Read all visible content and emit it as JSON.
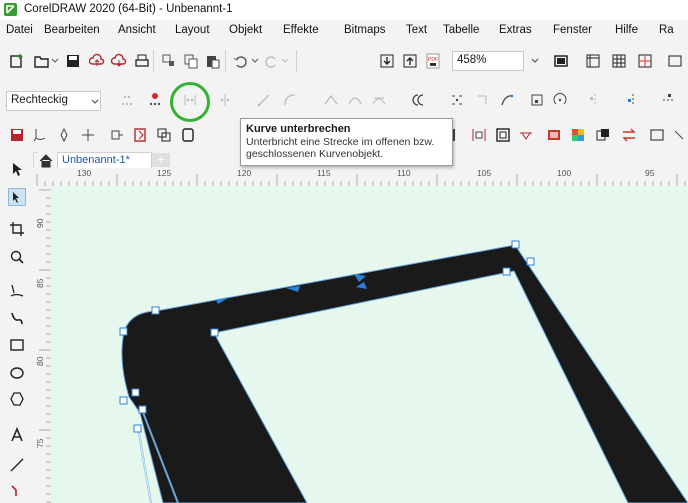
{
  "window": {
    "title": "CorelDRAW 2020 (64-Bit) - Unbenannt-1"
  },
  "menu": {
    "items": [
      "Datei",
      "Bearbeiten",
      "Ansicht",
      "Layout",
      "Objekt",
      "Effekte",
      "Bitmaps",
      "Text",
      "Tabelle",
      "Extras",
      "Fenster",
      "Hilfe",
      "Ra"
    ]
  },
  "standard_toolbar": {
    "zoom_value": "458%"
  },
  "property_bar": {
    "shape_type": "Rechteckig"
  },
  "tooltip": {
    "title": "Kurve unterbrechen",
    "body_line1": "Unterbricht eine Strecke im offenen bzw.",
    "body_line2": "geschlossenen Kurvenobjekt."
  },
  "document_tab": {
    "label": "Unbenannt-1*",
    "add_symbol": "+"
  },
  "horizontal_ruler": {
    "labels": [
      "130",
      "125",
      "120",
      "115",
      "110",
      "105",
      "100",
      "95"
    ]
  },
  "vertical_ruler": {
    "labels": [
      "90",
      "85",
      "80",
      "75"
    ]
  },
  "colors": {
    "canvas": "#e6f8ee",
    "shape_fill": "#1a1a1a",
    "highlight": "#34b233",
    "node_arrow": "#2a7fd6",
    "doc_tab_text": "#1d57a8"
  }
}
